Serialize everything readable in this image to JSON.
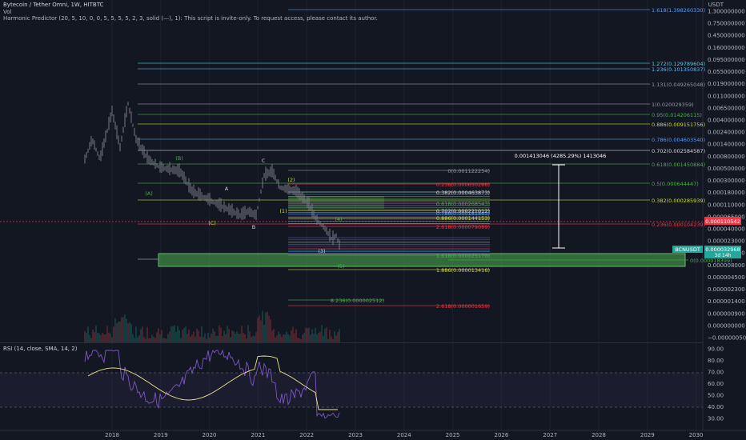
{
  "legend": {
    "symbol": "Bytecoin / Tether Omni, 1W, HITBTC",
    "vol": "Vol",
    "indicator": "Harmonic Predictor (20, 5, 10, 0, 0, 5, 5, 5, 5, 2, 3, solid (—), 1): This script is invite-only. To request access, please contact its author.",
    "rsi": "RSI (14, close, SMA, 14, 2)"
  },
  "axis": {
    "currency": "USDT",
    "price_ticks": [
      "1.300000000",
      "0.750000000",
      "0.450000000",
      "0.160000000",
      "0.095000000",
      "0.055000000",
      "0.019000000",
      "0.011000000",
      "0.006500000",
      "0.004000000",
      "0.002400000",
      "0.001400000",
      "0.000800000",
      "0.000500000",
      "0.000300000",
      "0.000180000",
      "0.000110000",
      "0.000065000",
      "0.000040000",
      "0.000023000",
      "0.000014000",
      "0.000008000",
      "0.000004500",
      "0.000002300",
      "0.000001400",
      "0.000000900",
      "0.000000000",
      "−0.000000500"
    ],
    "rsi_ticks": [
      "90.00",
      "80.00",
      "70.00",
      "60.00",
      "50.00",
      "40.00",
      "30.00"
    ],
    "time_ticks": [
      "2018",
      "2019",
      "2020",
      "2021",
      "2022",
      "2023",
      "2024",
      "2025",
      "2026",
      "2027",
      "2028",
      "2029",
      "2030"
    ]
  },
  "badges": {
    "last_price": "0.000032968",
    "symbol_short": "BCNUSDT",
    "countdown": "3d 14h",
    "red_level": "0.000110542"
  },
  "measure": {
    "label": "0.001413046 (4285.29%) 1413046"
  },
  "wave_labels": [
    "(A)",
    "(B)",
    "A",
    "C",
    "(C)",
    "B",
    "(2)",
    "(1)",
    "(3)",
    "(4)",
    "(5)"
  ],
  "fib_levels": [
    {
      "text": "1.618(1.398260330)",
      "color": "#5b9cf6"
    },
    {
      "text": "1.272(0.129789604)",
      "color": "#4dd0e1"
    },
    {
      "text": "1.236(0.101350837)",
      "color": "#64b5f6"
    },
    {
      "text": "1.131(0.049265048)",
      "color": "#9598a1"
    },
    {
      "text": "1(0.020029359)",
      "color": "#9598a1"
    },
    {
      "text": "0.95(0.014206115)",
      "color": "#4caf50"
    },
    {
      "text": "0.886(0.009151756)",
      "color": "#cddc39"
    },
    {
      "text": "0.786(0.004603540)",
      "color": "#5b9cf6"
    },
    {
      "text": "0.702(0.002584587)",
      "color": "#d1d4dc"
    },
    {
      "text": "0.618(0.001450884)",
      "color": "#4caf50"
    },
    {
      "text": "0.5(0.000644447)",
      "color": "#4caf50"
    },
    {
      "text": "0.382(0.000285939)",
      "color": "#cddc39"
    },
    {
      "text": "0.236(0.000104239)",
      "color": "#f23645"
    },
    {
      "text": "0(0.001122254)",
      "color": "#9598a1"
    },
    {
      "text": "0.236(0.000650286)",
      "color": "#f23645"
    },
    {
      "text": "0.382(0.000463873)",
      "color": "#d1d4dc"
    },
    {
      "text": "0.618(0.000268543)",
      "color": "#4caf50"
    },
    {
      "text": "0.702(0.000221012)",
      "color": "#d1d4dc"
    },
    {
      "text": "0.786(0.000181863)",
      "color": "#5b9cf6"
    },
    {
      "text": "0.886(0.000144153)",
      "color": "#cddc39"
    },
    {
      "text": "2.618(0.000079089)",
      "color": "#f23645"
    },
    {
      "text": "1.618(0.000025170)",
      "color": "#4caf50"
    },
    {
      "text": "0(0.000018399)",
      "color": "#4caf50"
    },
    {
      "text": "1.886(0.000013416)",
      "color": "#cddc39"
    },
    {
      "text": "8.236(0.000002512)",
      "color": "#4caf50"
    },
    {
      "text": "2.618(0.000001659)",
      "color": "#f23645"
    }
  ],
  "colors": {
    "background": "#131722",
    "candle": "#787b86",
    "rsi_line": "#7e57c2",
    "rsi_ma": "#f0e68c",
    "green_zone": "#4caf50",
    "badge_green": "#26a69a",
    "badge_red": "#f23645"
  }
}
